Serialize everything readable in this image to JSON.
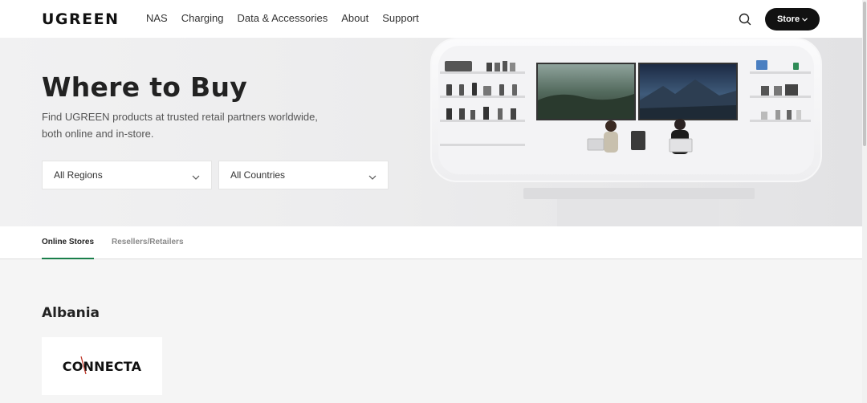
{
  "header": {
    "logo": "UGREEN",
    "nav": [
      "NAS",
      "Charging",
      "Data & Accessories",
      "About",
      "Support"
    ],
    "search_icon": "search-icon",
    "store_label": "Store"
  },
  "hero": {
    "title": "Where to Buy",
    "subtitle": "Find UGREEN products at trusted retail partners worldwide, both online and in-store.",
    "region_select": "All Regions",
    "country_select": "All Countries"
  },
  "tabs": {
    "online": "Online Stores",
    "resellers": "Resellers/Retailers"
  },
  "content": {
    "country": "Albania",
    "store_logo": "CONNECTA"
  },
  "colors": {
    "accent": "#1a7f4b",
    "dark": "#111111"
  }
}
